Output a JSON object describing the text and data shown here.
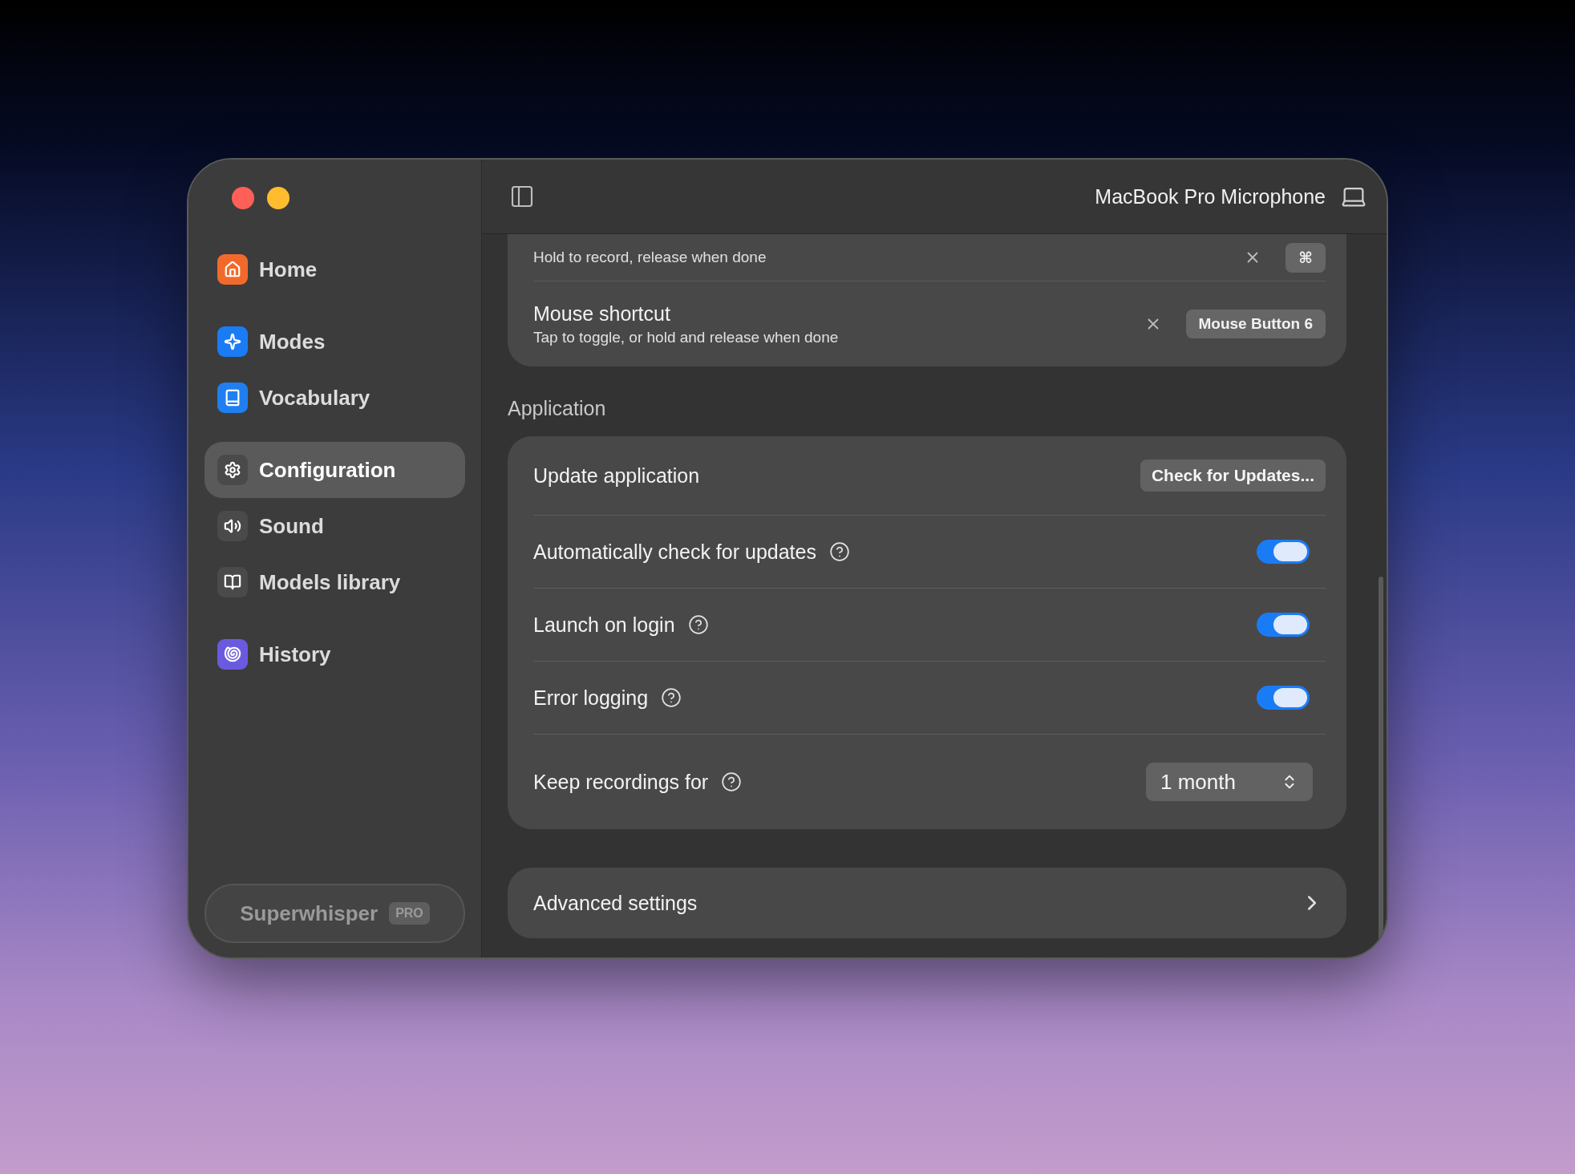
{
  "sidebar": {
    "sections": [
      [
        {
          "label": "Home",
          "selected": false
        }
      ],
      [
        {
          "label": "Modes",
          "selected": false
        },
        {
          "label": "Vocabulary",
          "selected": false
        }
      ],
      [
        {
          "label": "Configuration",
          "selected": true
        },
        {
          "label": "Sound",
          "selected": false
        },
        {
          "label": "Models library",
          "selected": false
        }
      ],
      [
        {
          "label": "History",
          "selected": false
        }
      ]
    ],
    "footer": {
      "brand": "Superwhisper",
      "badge": "PRO"
    }
  },
  "header": {
    "device": "MacBook Pro Microphone"
  },
  "shortcuts": {
    "rows": [
      {
        "subtitle": "Hold to record, release when done",
        "key": "⌘"
      },
      {
        "title": "Mouse shortcut",
        "subtitle": "Tap to toggle, or hold and release when done",
        "key": "Mouse Button 6"
      }
    ]
  },
  "application": {
    "heading": "Application",
    "rows": [
      {
        "kind": "button",
        "label": "Update application",
        "button": "Check for Updates..."
      },
      {
        "kind": "toggle",
        "label": "Automatically check for updates",
        "help": true,
        "on": true
      },
      {
        "kind": "toggle",
        "label": "Launch on login",
        "help": true,
        "on": true
      },
      {
        "kind": "toggle",
        "label": "Error logging",
        "help": true,
        "on": true
      },
      {
        "kind": "select",
        "label": "Keep recordings for",
        "help": true,
        "value": "1 month"
      }
    ]
  },
  "advanced": {
    "label": "Advanced settings"
  }
}
